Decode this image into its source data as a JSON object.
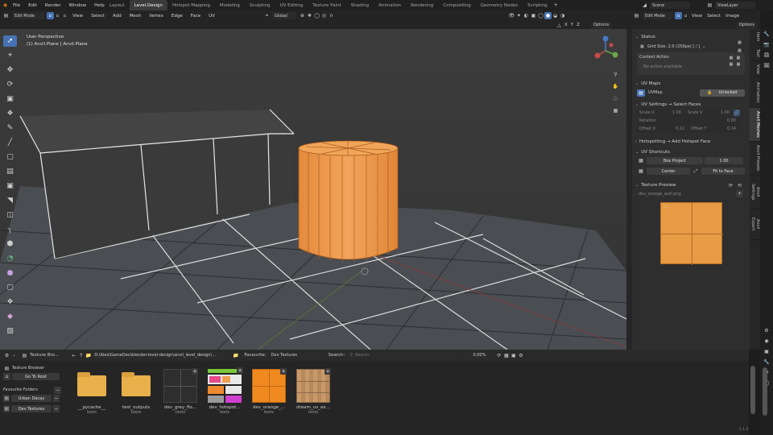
{
  "menus": [
    "File",
    "Edit",
    "Render",
    "Window",
    "Help"
  ],
  "workspaces": [
    "Layout",
    "Level.Design",
    "Hotspot Mapping",
    "Modeling",
    "Sculpting",
    "UV Editing",
    "Texture Paint",
    "Shading",
    "Animation",
    "Rendering",
    "Compositing",
    "Geometry Nodes",
    "Scripting"
  ],
  "scene_name": "Scene",
  "view_layer": "ViewLayer",
  "viewport": {
    "mode": "Edit Mode",
    "menus": [
      "View",
      "Select",
      "Add",
      "Mesh",
      "Vertex",
      "Edge",
      "Face",
      "UV"
    ],
    "transform": "Global",
    "xyz": [
      "X",
      "Y",
      "Z"
    ],
    "options": "Options",
    "perspective": "User Perspective",
    "object": "(1) Anvil.Plane | Anvil.Plane"
  },
  "uv_header": {
    "mode": "Edit Mode",
    "menus": [
      "View",
      "Select",
      "Image"
    ],
    "options": "Options"
  },
  "sidebar": {
    "status_title": "Status",
    "grid_size": "Grid Size: 2.0  (256px)  [ / ]",
    "context_title": "Context Action",
    "context_msg": "No action available",
    "uvmaps_title": "UV Maps",
    "uvmap_name": "UVMap",
    "unlocked": "Unlocked",
    "uvsettings_title": "UV Settings  → Select Faces",
    "scale_u": "Scale U",
    "scale_u_val": "1.00",
    "scale_v": "Scale V",
    "scale_v_val": "1.00",
    "rotation": "Rotation",
    "rotation_val": "0.00",
    "offset_x": "Offset X",
    "offset_x_val": "0.22",
    "offset_y": "Offset Y",
    "offset_y_val": "0.14",
    "hotspot_title": "Hotspotting  → Add Hotspot Face",
    "shortcuts_title": "UV Shortcuts",
    "box_project": "Box Project",
    "box_project_val": "1.00",
    "center": "Center",
    "fit_to_face": "Fit to Face",
    "preview_title": "Texture Preview",
    "preview_file": "dev_orange_wall.png",
    "preview_badge": "REF"
  },
  "tabs": [
    "Item",
    "Tool",
    "View",
    "Animation",
    "Anvil Meshes",
    "Anvil Presets",
    "Anvil Settings",
    "Anvil Export"
  ],
  "browser": {
    "title": "Texture Bro...",
    "path": "D:\\Alex\\GameDev\\blender-level-design\\anvil_level_design\\...",
    "favourite_label": "Favourite:",
    "favourite_value": "Dev Textures",
    "search_label": "Search:",
    "search_placeholder": "Search",
    "zoom": "0.00%",
    "side_title": "Texture Browser",
    "go_root": "Go To Root",
    "fav_folders": "Favourite Folders",
    "folders": [
      "Urban Decay",
      "Dev Textures"
    ],
    "items": [
      {
        "name": "__pycache__",
        "sub": "tests",
        "kind": "folder"
      },
      {
        "name": "test_outputs",
        "sub": "tests",
        "kind": "folder"
      },
      {
        "name": "dev_grey_flo...",
        "sub": "tests",
        "kind": "grey"
      },
      {
        "name": "dev_hotspot...",
        "sub": "tests",
        "kind": "hotspot"
      },
      {
        "name": "dev_orange_...",
        "sub": "tests",
        "kind": "orange"
      },
      {
        "name": "dream_uv_ex...",
        "sub": "tests",
        "kind": "wood"
      }
    ],
    "version": "5.1.2"
  },
  "colors": {
    "accent": "#4772b3",
    "orange": "#f0a050",
    "grid": "#c9c9c9"
  }
}
